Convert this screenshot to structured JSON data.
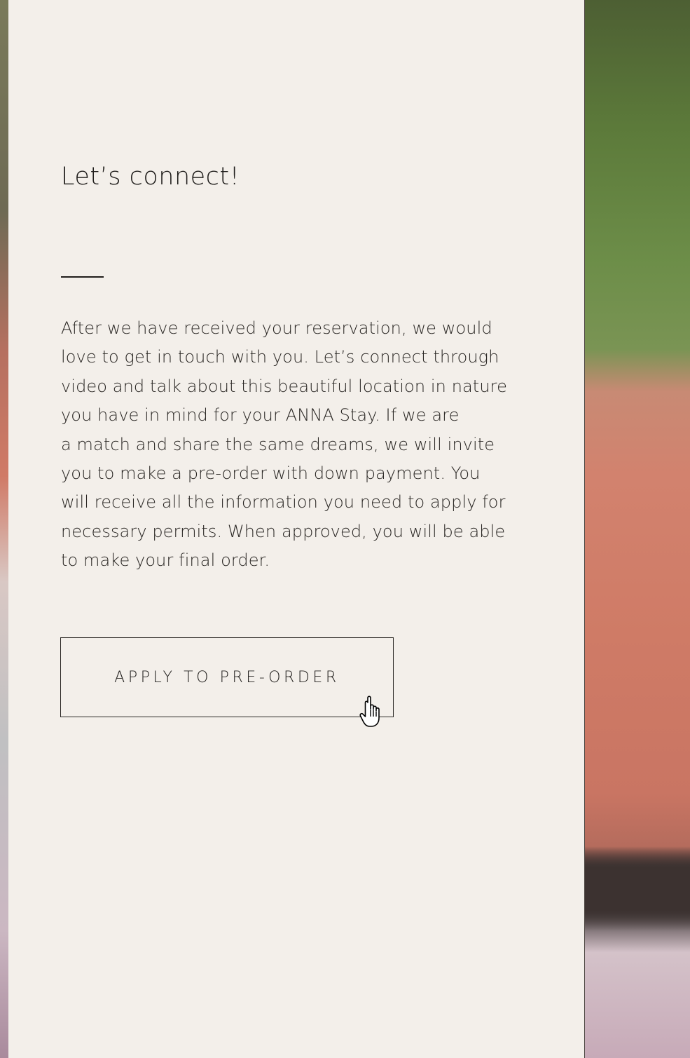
{
  "section": {
    "heading": "Let’s connect!",
    "body_lines": [
      "After we have received your reservation, we would",
      "love to get in touch with you. Let’s connect through",
      "video and talk about this beautiful location in nature",
      "you have in mind for your ANNA Stay. If we are",
      "a match and share the same dreams, we will invite",
      "you to make a pre-order with down payment. You",
      "will receive all the information you need to apply for",
      "necessary permits. When approved, you will be able",
      "to make your final order."
    ],
    "cta_label": "APPLY TO PRE-ORDER"
  },
  "colors": {
    "panel_background": "#f3efea",
    "text": "#1f1d1b"
  },
  "icons": {
    "cursor": "pointer-hand-cursor-icon"
  }
}
